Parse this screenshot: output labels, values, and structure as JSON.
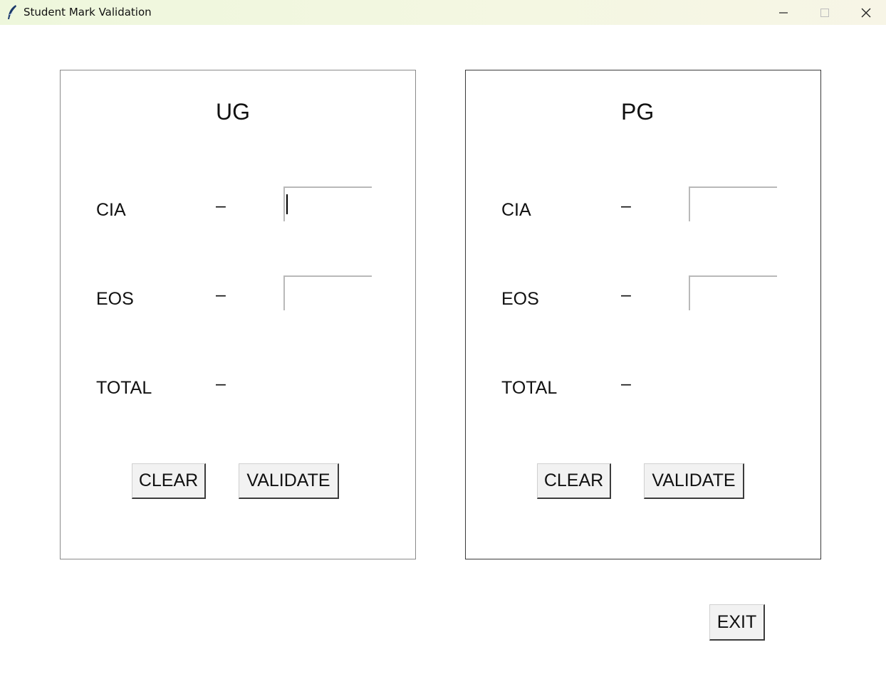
{
  "window": {
    "title": "Student Mark Validation",
    "icon": "feather-icon",
    "controls": [
      "minimize-icon",
      "maximize-icon",
      "close-icon"
    ]
  },
  "panels": [
    {
      "title": "UG",
      "rows": [
        {
          "label": "CIA",
          "separator": "–",
          "value": ""
        },
        {
          "label": "EOS",
          "separator": "–",
          "value": ""
        },
        {
          "label": "TOTAL",
          "separator": "–"
        }
      ],
      "clear_label": "CLEAR",
      "validate_label": "VALIDATE"
    },
    {
      "title": "PG",
      "rows": [
        {
          "label": "CIA",
          "separator": "–",
          "value": ""
        },
        {
          "label": "EOS",
          "separator": "–",
          "value": ""
        },
        {
          "label": "TOTAL",
          "separator": "–"
        }
      ],
      "clear_label": "CLEAR",
      "validate_label": "VALIDATE"
    }
  ],
  "exit_label": "EXIT"
}
